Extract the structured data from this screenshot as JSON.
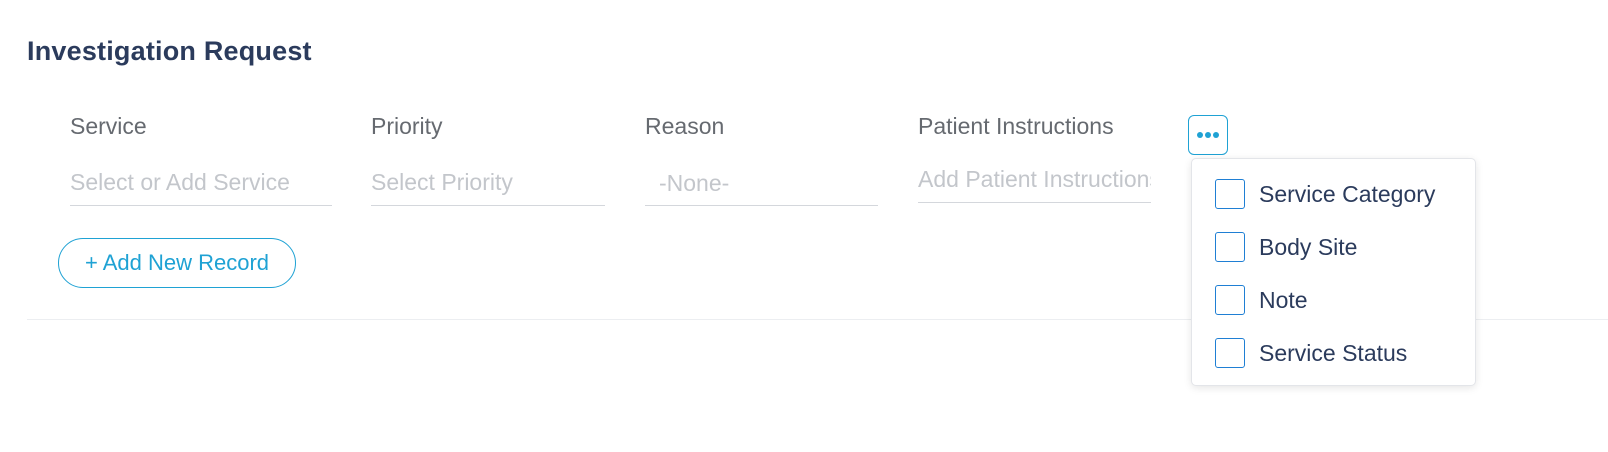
{
  "section": {
    "title": "Investigation Request"
  },
  "columns": {
    "service": {
      "label": "Service",
      "placeholder": "Select or Add Service"
    },
    "priority": {
      "label": "Priority",
      "placeholder": "Select Priority"
    },
    "reason": {
      "label": "Reason",
      "value": "-None-"
    },
    "patient_instructions": {
      "label": "Patient Instructions",
      "placeholder": "Add Patient Instructions"
    }
  },
  "actions": {
    "more_icon": "more-horizontal-icon",
    "add_record_label": "+ Add New Record"
  },
  "dropdown": {
    "items": [
      {
        "label": "Service Category",
        "checked": false
      },
      {
        "label": "Body Site",
        "checked": false
      },
      {
        "label": "Note",
        "checked": false
      },
      {
        "label": "Service Status",
        "checked": false
      }
    ]
  },
  "colors": {
    "accent": "#1fa2d4",
    "title": "#2b3b5c",
    "checkbox_border": "#1f7fd4"
  }
}
